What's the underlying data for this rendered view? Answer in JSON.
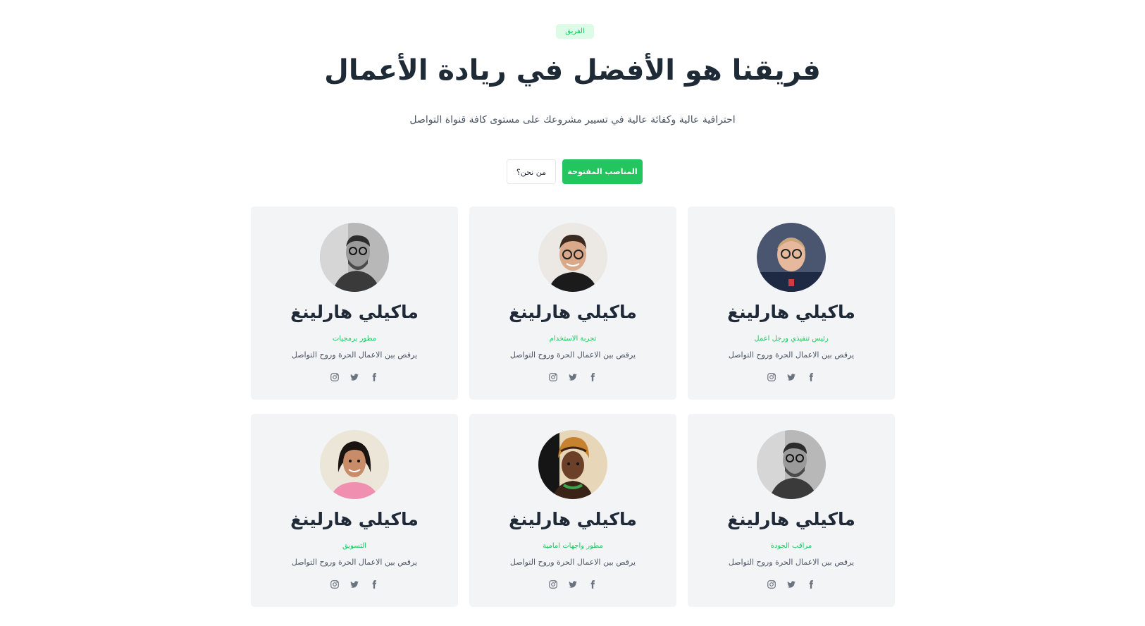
{
  "header": {
    "badge": "الفريق",
    "title": "فريقنا هو الأفضل في ريادة الأعمال",
    "subtitle": "احترافية عالية وكفائة عالية في تسيير مشروعك على مستوى كافة قنواة التواصل"
  },
  "actions": {
    "primary_label": "المناصب المفتوحة",
    "secondary_label": "من نحن؟"
  },
  "team": [
    {
      "name": "ماكيلي هارلينغ",
      "role": "رئيس تنفيذي ورجل اعمل",
      "bio": "يرقص بين الاعمال الحرة وروح التواصل",
      "avatar": "man-glasses-navy-shirt"
    },
    {
      "name": "ماكيلي هارلينغ",
      "role": "تجربة الاستخدام",
      "bio": "يرقص بين الاعمال الحرة وروح التواصل",
      "avatar": "man-glasses-black-tee"
    },
    {
      "name": "ماكيلي هارلينغ",
      "role": "مطور برمجيات",
      "bio": "يرقص بين الاعمال الحرة وروح التواصل",
      "avatar": "man-beard-grayscale"
    },
    {
      "name": "ماكيلي هارلينغ",
      "role": "مراقب الجودة",
      "bio": "يرقص بين الاعمال الحرة وروح التواصل",
      "avatar": "man-beard-grayscale"
    },
    {
      "name": "ماكيلي هارلينغ",
      "role": "مطور واجهات امامية",
      "bio": "يرقص بين الاعمال الحرة وروح التواصل",
      "avatar": "woman-headwrap"
    },
    {
      "name": "ماكيلي هارلينغ",
      "role": "التسويق",
      "bio": "يرقص بين الاعمال الحرة وروح التواصل",
      "avatar": "woman-pink-top"
    }
  ],
  "social_icons": [
    "facebook-icon",
    "twitter-icon",
    "instagram-icon"
  ],
  "colors": {
    "accent": "#22c55e",
    "badge_bg": "#dcfce7",
    "card_bg": "#f3f4f6",
    "heading": "#1f2937",
    "muted": "#4b5563",
    "icon": "#6b7280"
  }
}
